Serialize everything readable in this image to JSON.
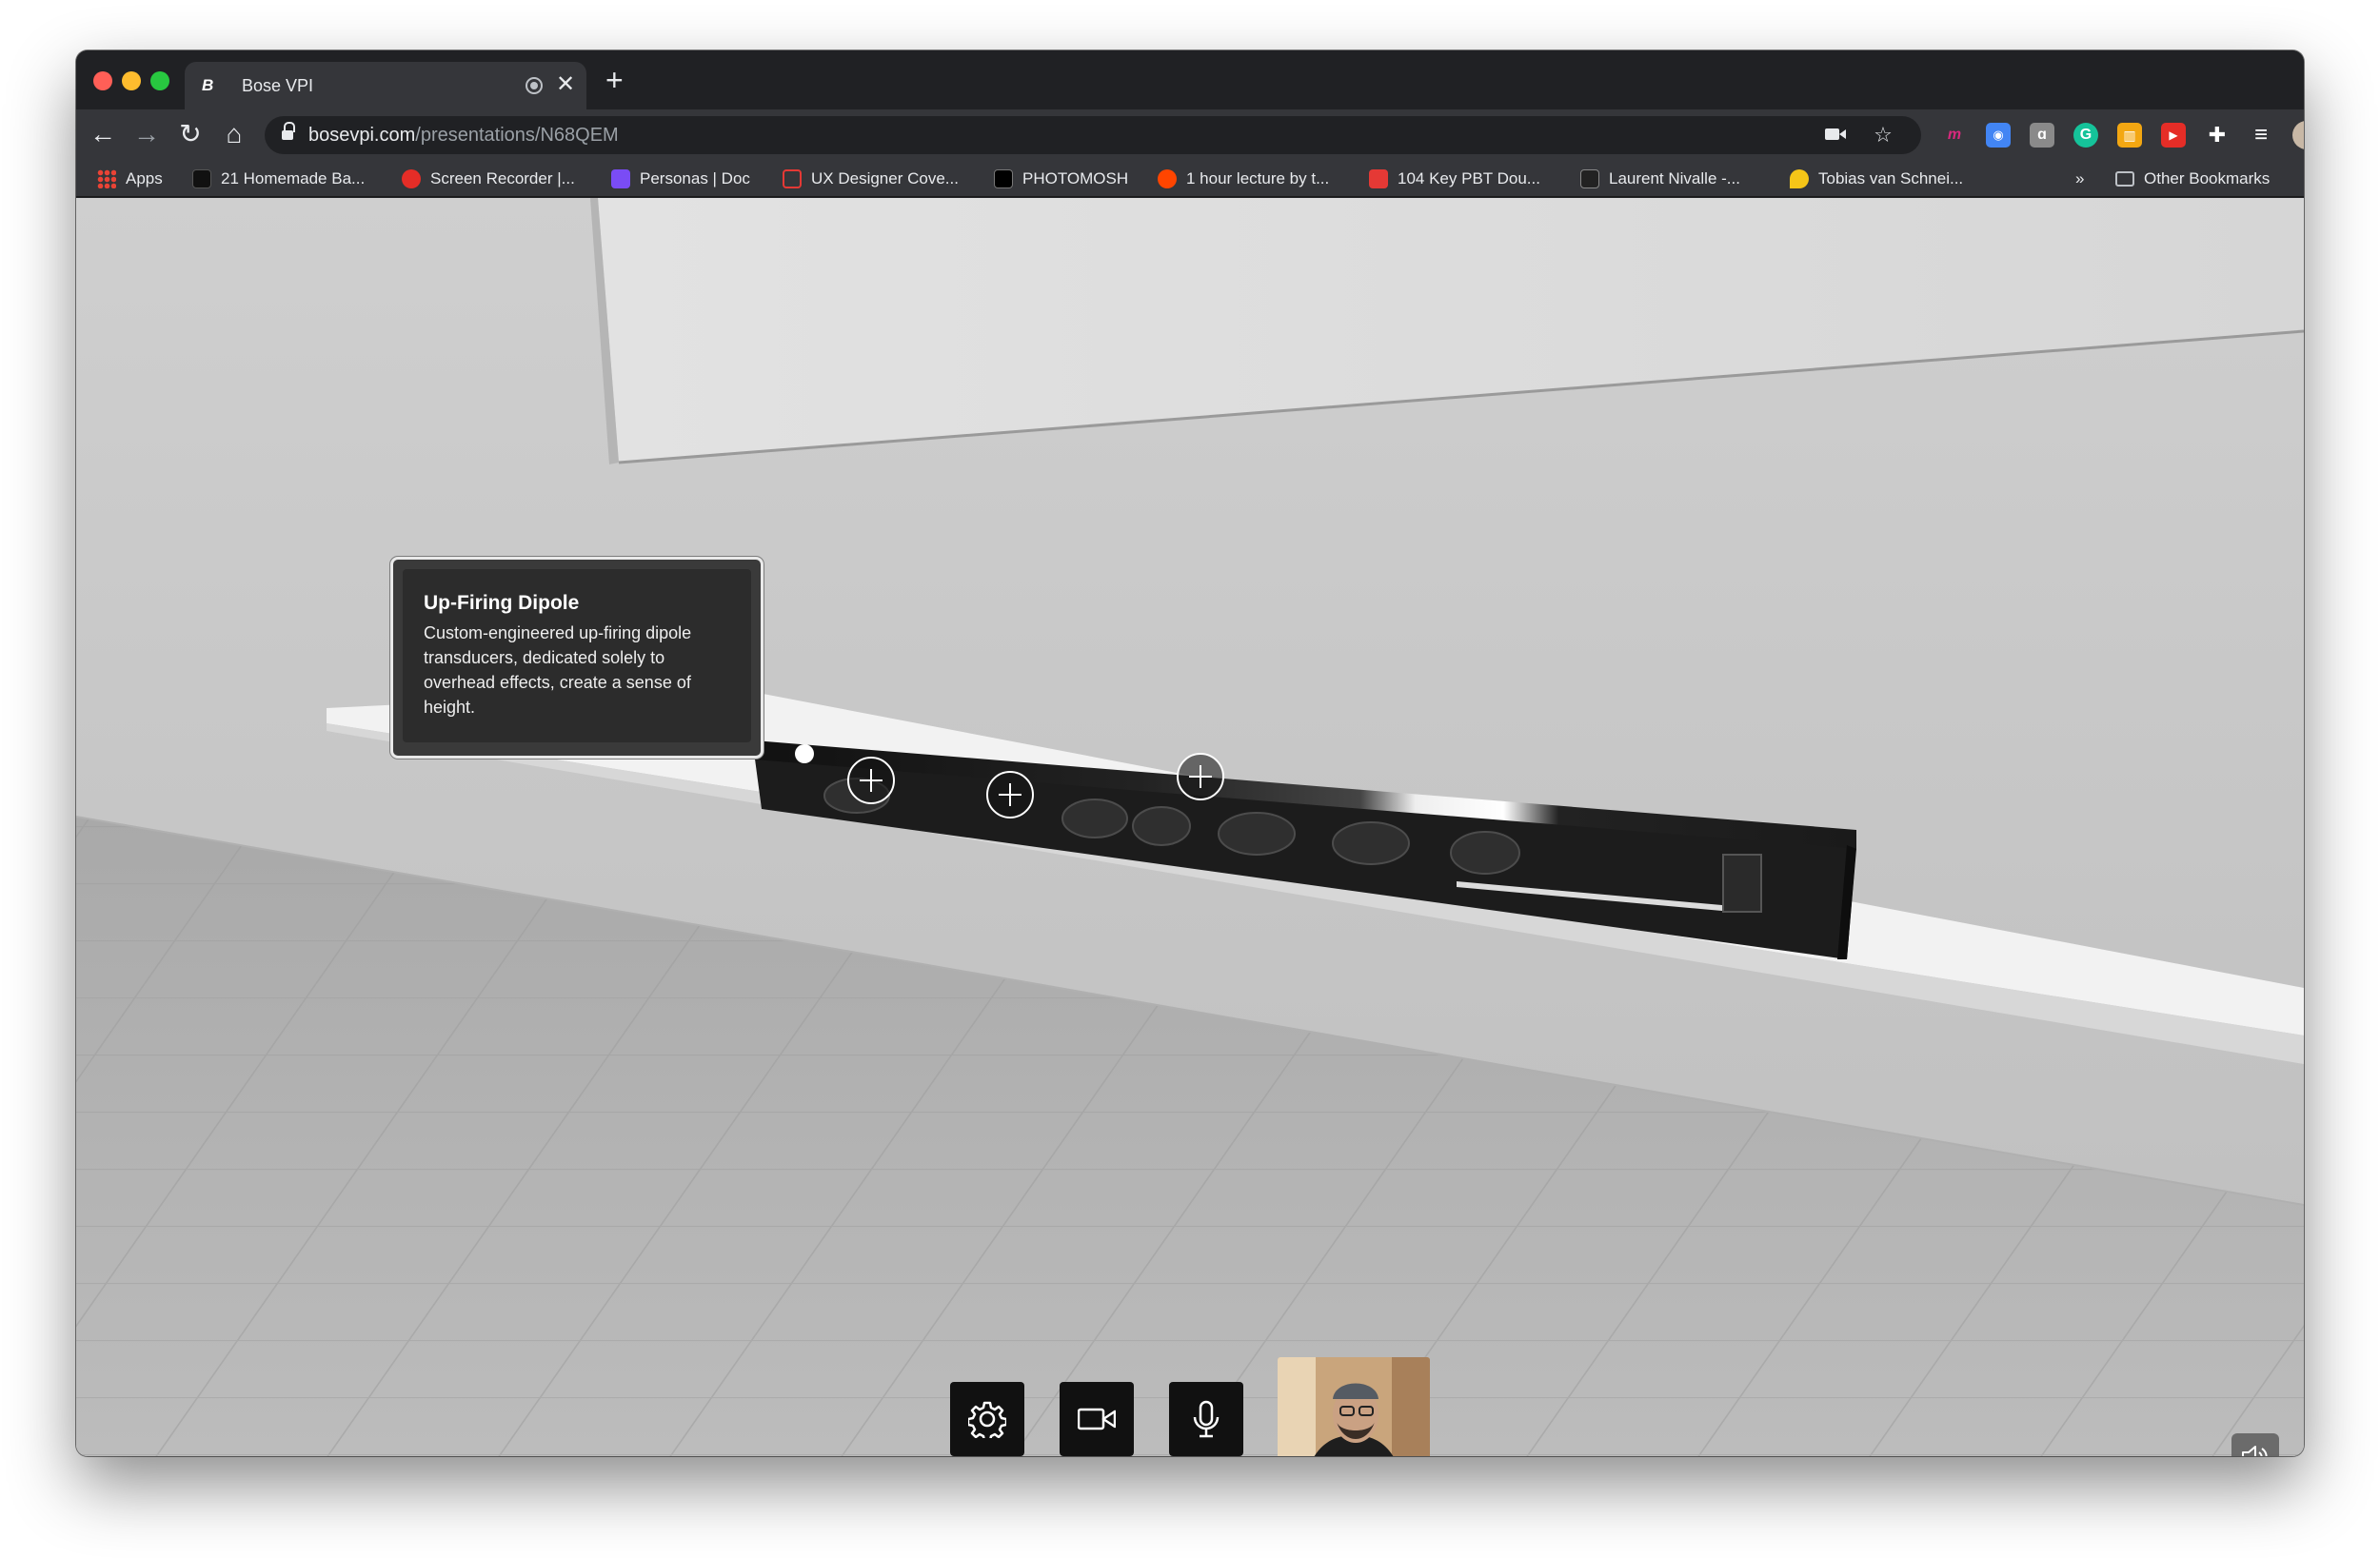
{
  "browser": {
    "tab": {
      "title": "Bose VPI",
      "favicon": "bose-logo-icon",
      "favicon_text": "B",
      "close_glyph": "✕"
    },
    "new_tab_glyph": "+",
    "nav": {
      "back_glyph": "←",
      "forward_glyph": "→",
      "reload_glyph": "↻",
      "home_glyph": "⌂"
    },
    "url": {
      "host": "bosevpi.com",
      "path": "/presentations/N68QEM"
    },
    "omnibox_icons": [
      "camera-icon",
      "star-icon"
    ],
    "extensions": [
      {
        "name": "monday-extension-icon",
        "glyph": "m",
        "color": "#d8297d"
      },
      {
        "name": "screen-capture-extension-icon",
        "glyph": "◉",
        "color": "#4285f4"
      },
      {
        "name": "readability-extension-icon",
        "glyph": "ɑ",
        "color": "#8a8a8a"
      },
      {
        "name": "grammarly-extension-icon",
        "glyph": "G",
        "color": "#15c39a"
      },
      {
        "name": "bar-chart-extension-icon",
        "glyph": "▥",
        "color": "#f3a712"
      },
      {
        "name": "youtube-extension-icon",
        "glyph": "▶",
        "color": "#e52d27"
      },
      {
        "name": "puzzle-extensions-icon",
        "glyph": "✚",
        "color": "#35363a"
      },
      {
        "name": "reading-list-icon",
        "glyph": "≡",
        "color": "#35363a"
      }
    ],
    "bookmarks": [
      {
        "label": "Apps",
        "icon": "apps-grid-icon",
        "color": "#ea4335"
      },
      {
        "label": "21 Homemade Ba...",
        "icon": "document-icon",
        "color": "#ffffff"
      },
      {
        "label": "Screen Recorder |...",
        "icon": "record-icon",
        "color": "#e52d27"
      },
      {
        "label": "Personas | Doc",
        "icon": "personas-icon",
        "color": "#7a4cf5"
      },
      {
        "label": "UX Designer Cove...",
        "icon": "gmail-icon",
        "color": "#e53935"
      },
      {
        "label": "PHOTOMOSH",
        "icon": "photomosh-icon",
        "color": "#000000"
      },
      {
        "label": "1 hour lecture by t...",
        "icon": "reddit-icon",
        "color": "#ff4500"
      },
      {
        "label": "104 Key PBT Dou...",
        "icon": "keyboard-shop-icon",
        "color": "#e53935"
      },
      {
        "label": "Laurent Nivalle -...",
        "icon": "sparkle-icon",
        "color": "#222222"
      },
      {
        "label": "Tobias van Schnei...",
        "icon": "banana-icon",
        "color": "#f5c518"
      }
    ],
    "bookmarks_overflow": "»",
    "other_bookmarks": "Other Bookmarks"
  },
  "scene": {
    "info_card": {
      "title": "Up-Firing Dipole",
      "body": "Custom-engineered up-firing dipole transducers, dedicated solely to overhead effects, create a sense of height."
    },
    "hotspots": [
      "hotspot-1",
      "hotspot-2",
      "hotspot-3"
    ],
    "controls": [
      "settings-button",
      "camera-toggle-button",
      "microphone-toggle-button"
    ],
    "volume_icon": "speaker-icon"
  },
  "colors": {
    "chrome_dark": "#202124",
    "chrome_toolbar": "#35363a",
    "scene_wall": "#c9c9c9",
    "card_bg": "#2c2c2c"
  }
}
